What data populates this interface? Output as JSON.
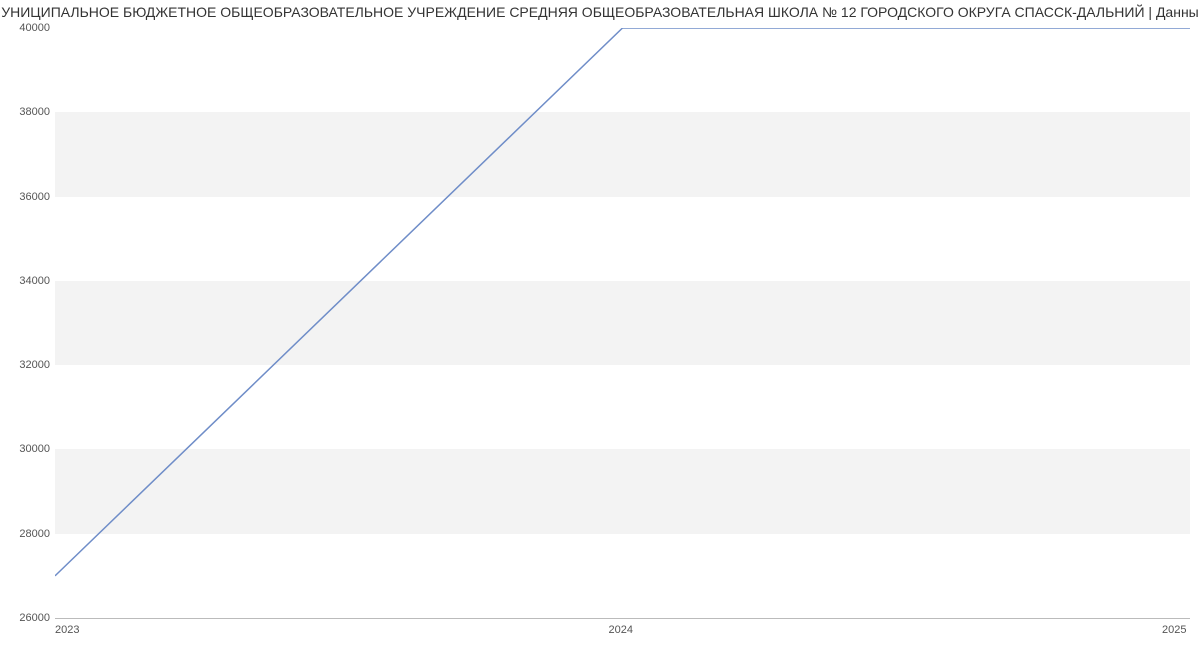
{
  "chart_data": {
    "type": "line",
    "title": "УНИЦИПАЛЬНОЕ БЮДЖЕТНОЕ ОБЩЕОБРАЗОВАТЕЛЬНОЕ УЧРЕЖДЕНИЕ СРЕДНЯЯ ОБЩЕОБРАЗОВАТЕЛЬНАЯ ШКОЛА № 12 ГОРОДСКОГО ОКРУГА СПАССК-ДАЛЬНИЙ | Данны",
    "x": [
      2023,
      2024,
      2025
    ],
    "values": [
      27000,
      40000,
      40000
    ],
    "xlabel": "",
    "ylabel": "",
    "xlim": [
      2023,
      2025
    ],
    "ylim": [
      26000,
      40000
    ],
    "yticks": [
      26000,
      28000,
      30000,
      32000,
      34000,
      36000,
      38000,
      40000
    ],
    "xticks": [
      2023,
      2024,
      2025
    ],
    "grid": true,
    "line_color": "#6f8dc8"
  }
}
